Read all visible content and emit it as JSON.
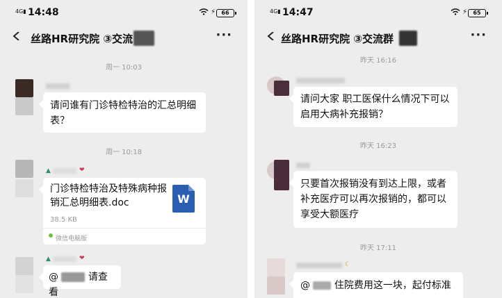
{
  "colors": {
    "chat_bg": "#ededed",
    "bubble": "#ffffff",
    "word_icon": "#2b5db0",
    "timestamp": "#9a9a9a"
  },
  "left": {
    "status": {
      "time": "14:48",
      "signal": "4G",
      "battery": "66"
    },
    "header": {
      "title": "丝路HR研究院 ③交流",
      "more": "···"
    },
    "messages": [
      {
        "timestamp": "周一 10:03",
        "text": "请问谁有门诊特检特治的汇总明细表？"
      },
      {
        "timestamp": "周一 10:18",
        "file": {
          "name": "门诊特检特治及特殊病种报销汇总明细表.doc",
          "size": "38.5 KB",
          "icon_letter": "W",
          "source": "微信电脑版"
        }
      },
      {
        "mention": "@",
        "text": "请查看"
      }
    ]
  },
  "right": {
    "status": {
      "time": "14:47",
      "signal": "4G",
      "battery": "65"
    },
    "header": {
      "title": "丝路HR研究院 ③交流群",
      "more": "···"
    },
    "messages": [
      {
        "timestamp": "昨天 16:16",
        "text": "请问大家 职工医保什么情况下可以启用大病补充报销？"
      },
      {
        "timestamp": "昨天 16:23",
        "text": "只要首次报销没有到达上限，或者补充医疗可以再次报销的，都可以享受大额医疗"
      },
      {
        "timestamp": "昨天 17:11",
        "mention": "@",
        "text": "住院费用这一块，起付标准"
      }
    ]
  }
}
